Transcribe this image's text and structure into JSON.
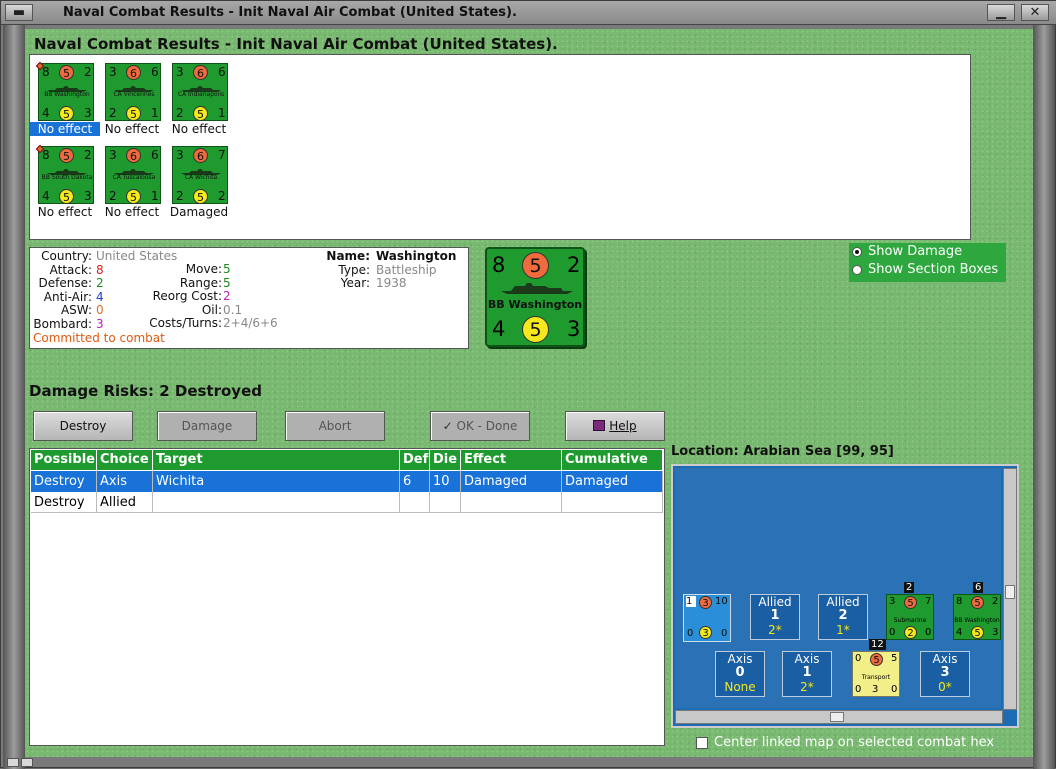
{
  "window": {
    "title": "Naval Combat Results - Init Naval Air Combat (United States)."
  },
  "heading": "Naval Combat Results - Init Naval Air Combat (United States).",
  "units": [
    {
      "name": "BB Washington",
      "tl": "8",
      "tm": "5",
      "tr": "2",
      "bl": "4",
      "bm": "5",
      "br": "3",
      "result": "No effect"
    },
    {
      "name": "CA Vincennes",
      "tl": "3",
      "tm": "6",
      "tr": "6",
      "bl": "2",
      "bm": "5",
      "br": "1",
      "result": "No effect"
    },
    {
      "name": "CA Indianapolis",
      "tl": "3",
      "tm": "6",
      "tr": "6",
      "bl": "2",
      "bm": "5",
      "br": "1",
      "result": "No effect"
    },
    {
      "name": "BB South Dakota",
      "tl": "8",
      "tm": "5",
      "tr": "2",
      "bl": "4",
      "bm": "5",
      "br": "3",
      "result": "No effect"
    },
    {
      "name": "CA Tuscaloosa",
      "tl": "3",
      "tm": "6",
      "tr": "6",
      "bl": "2",
      "bm": "5",
      "br": "1",
      "result": "No effect"
    },
    {
      "name": "CA Wichita",
      "tl": "3",
      "tm": "6",
      "tr": "7",
      "bl": "2",
      "bm": "5",
      "br": "2",
      "result": "Damaged"
    }
  ],
  "info": {
    "country_label": "Country:",
    "country": "United States",
    "attack_label": "Attack:",
    "attack": "8",
    "defense_label": "Defense:",
    "defense": "2",
    "antiair_label": "Anti-Air:",
    "antiair": "4",
    "asw_label": "ASW:",
    "asw": "0",
    "bombard_label": "Bombard:",
    "bombard": "3",
    "move_label": "Move:",
    "move": "5",
    "range_label": "Range:",
    "range": "5",
    "reorg_label": "Reorg Cost:",
    "reorg": "2",
    "oil_label": "Oil:",
    "oil": "0.1",
    "costs_label": "Costs/Turns:",
    "costs": "2+4/6+6",
    "name_label": "Name:",
    "name": "Washington",
    "type_label": "Type:",
    "type": "Battleship",
    "year_label": "Year:",
    "year": "1938",
    "status": "Committed to combat"
  },
  "big_counter": {
    "name": "BB Washington",
    "tl": "8",
    "tm": "5",
    "tr": "2",
    "bl": "4",
    "bm": "5",
    "br": "3"
  },
  "options": {
    "show_damage": "Show Damage",
    "show_section_boxes": "Show Section Boxes"
  },
  "damage_risks": "Damage Risks:  2 Destroyed",
  "buttons": {
    "destroy": "Destroy",
    "damage": "Damage",
    "abort": "Abort",
    "ok": "OK - Done",
    "help": "Help"
  },
  "table": {
    "headers": [
      "Possible",
      "Choice",
      "Target",
      "Def",
      "Die",
      "Effect",
      "Cumulative"
    ],
    "rows": [
      [
        "Destroy",
        "Axis",
        "Wichita",
        "6",
        "10",
        "Damaged",
        "Damaged"
      ],
      [
        "Destroy",
        "Allied",
        "",
        "",
        "",
        "",
        ""
      ]
    ]
  },
  "location": "Location:  Arabian Sea [99, 95]",
  "map": {
    "allied_cells": [
      {
        "label": "Allied",
        "num": "1",
        "sub": "2*"
      },
      {
        "label": "Allied",
        "num": "2",
        "sub": "1*"
      }
    ],
    "axis_cells": [
      {
        "label": "Axis",
        "num": "0",
        "sub": "None"
      },
      {
        "label": "Axis",
        "num": "1",
        "sub": "2*"
      },
      {
        "label": "Axis",
        "num": "3",
        "sub": "0*"
      }
    ],
    "badges": {
      "sub_stack": "2",
      "bb_stack": "6",
      "transport_stack": "12"
    },
    "unit_names": {
      "submarine": "Submarine",
      "bb": "BB Washington",
      "transport": "Transport"
    }
  },
  "center_map_label": "Center linked map on selected combat hex",
  "colors": {
    "felt": "#79b870",
    "counter_green": "#1e9a2e",
    "selection": "#1872d8",
    "header_green": "#1e9a2e"
  }
}
